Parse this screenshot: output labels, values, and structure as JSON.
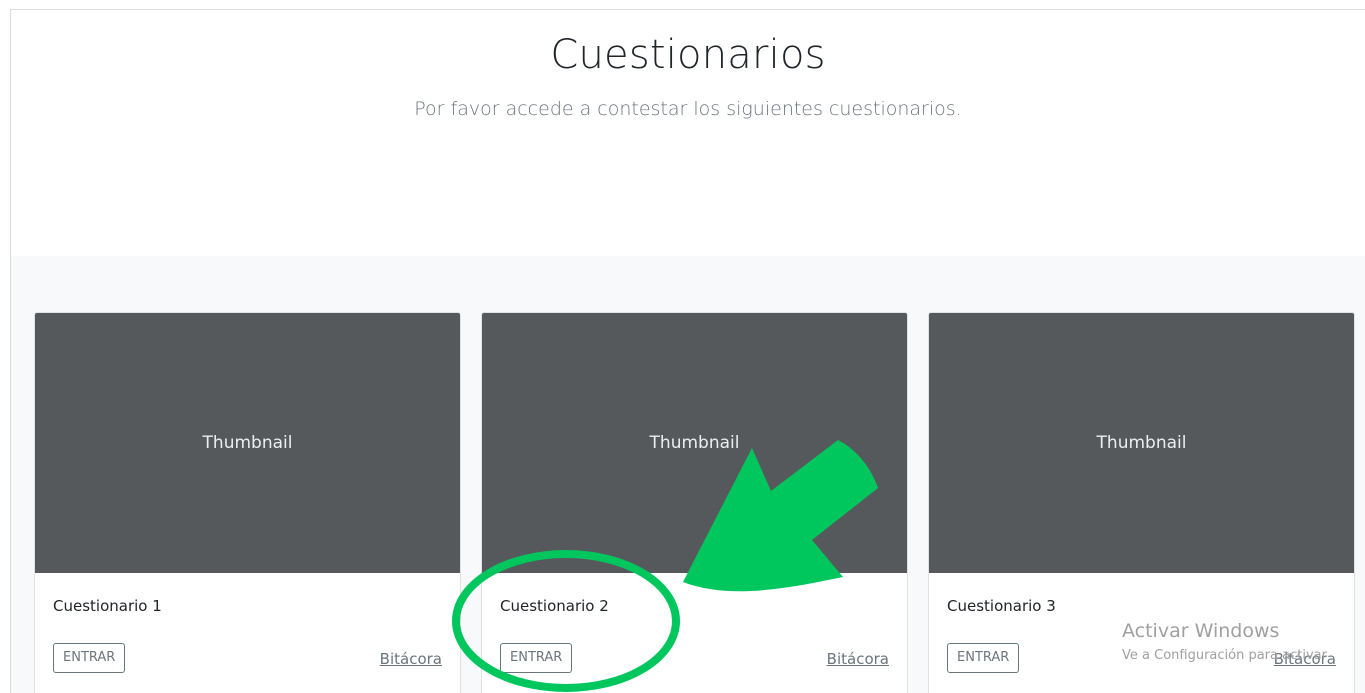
{
  "header": {
    "title": "Cuestionarios",
    "lead": "Por favor accede a contestar los siguientes cuestionarios."
  },
  "cards": [
    {
      "thumbnail": "Thumbnail",
      "title": "Cuestionario 1",
      "button": "ENTRAR",
      "link": "Bitácora"
    },
    {
      "thumbnail": "Thumbnail",
      "title": "Cuestionario 2",
      "button": "ENTRAR",
      "link": "Bitácora"
    },
    {
      "thumbnail": "Thumbnail",
      "title": "Cuestionario 3",
      "button": "ENTRAR",
      "link": "Bitácora"
    }
  ],
  "watermark": {
    "line1": "Activar Windows",
    "line2": "Ve a Configuración para activar"
  },
  "annotation": {
    "arrow_color": "#00c65e",
    "circle_color": "#00c65e"
  },
  "colors": {
    "thumbnail_bg": "#55595c",
    "album_bg": "#f8f9fa"
  }
}
